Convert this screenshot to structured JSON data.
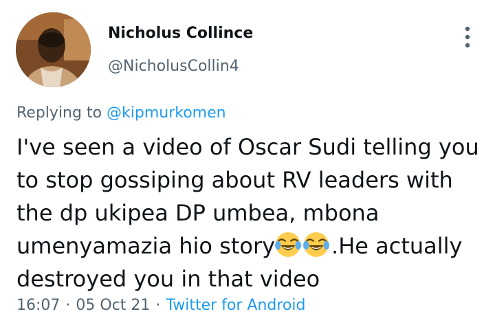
{
  "tweet": {
    "display_name": "Nicholus Collince",
    "handle": "@NicholusCollin4",
    "replying_prefix": "Replying to",
    "replying_to": "@kipmurkomen",
    "text_before_emoji": "I've seen a video of Oscar Sudi telling you to stop gossiping about RV leaders with the dp ukipea DP umbea, mbona umenyamazia hio story",
    "emojis": [
      "face-with-tears-of-joy-icon",
      "face-with-tears-of-joy-icon"
    ],
    "text_after_emoji": ".He actually destroyed you in that video",
    "time": "16:07",
    "date": "05 Oct 21",
    "separator": "·",
    "source": "Twitter for Android"
  },
  "icons": {
    "more": "more-vertical-icon",
    "avatar": "avatar"
  },
  "colors": {
    "text": "#0f1419",
    "secondary": "#536471",
    "link": "#1d9bf0",
    "background": "#ffffff"
  }
}
